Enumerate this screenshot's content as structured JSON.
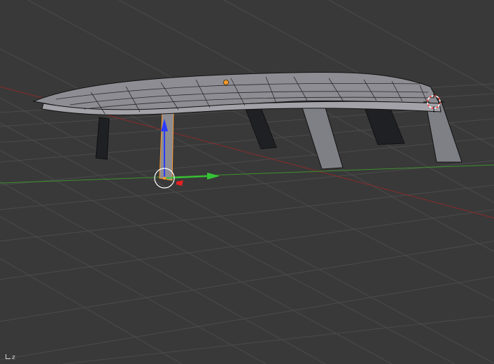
{
  "viewport": {
    "axis_indicator_label": "z",
    "colors": {
      "background": "#393939",
      "grid": "#555555",
      "x_axis": "#8b2a2a",
      "y_axis": "#3f8f2f",
      "mesh_face": "#8d8d93",
      "mesh_dark": "#1f2024",
      "mesh_edge": "#111111",
      "selection": "#ff9a2a",
      "gizmo_x": "#e52020",
      "gizmo_y": "#36c236",
      "gizmo_z": "#2a3cff"
    },
    "icons": [
      "3d-cursor-icon",
      "origin-dot-icon",
      "transform-gizmo-icon"
    ]
  }
}
